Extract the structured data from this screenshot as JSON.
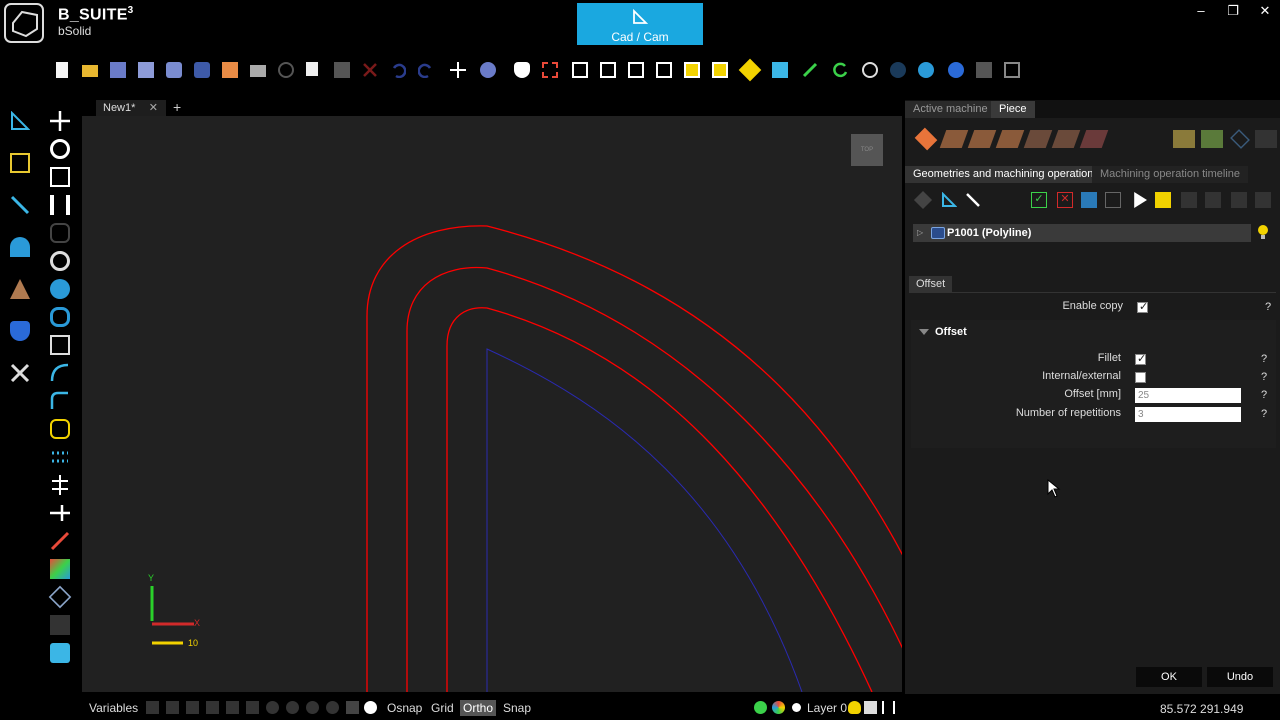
{
  "app": {
    "name": "B_SUITE",
    "name_sup": "3",
    "subtitle": "bSolid",
    "mode_button": "Cad / Cam"
  },
  "window_controls": [
    "–",
    "❐",
    "✕"
  ],
  "document_tabs": [
    {
      "label": "New1*"
    }
  ],
  "canvas": {
    "view_cube": "TOP",
    "axis": {
      "y_label": "Y",
      "x_label": "X",
      "scale_label": "10"
    }
  },
  "statusbar": {
    "variables": "Variables",
    "osnap": "Osnap",
    "grid": "Grid",
    "ortho": "Ortho",
    "snap": "Snap",
    "layer": "Layer 0"
  },
  "coordinates": "85.572  291.949",
  "right_panel": {
    "tabs": [
      "Active machine",
      "Piece"
    ],
    "active_tab": "Piece",
    "sub_tabs": [
      "Geometries and machining operations",
      "Machining operation timeline"
    ],
    "tree_item": "P1001 (Polyline)",
    "offset_tab": "Offset",
    "enable_copy": {
      "label": "Enable copy",
      "checked": true
    },
    "section_title": "Offset",
    "properties": {
      "fillet": {
        "label": "Fillet",
        "checked": true
      },
      "internal_external": {
        "label": "Internal/external",
        "checked": false
      },
      "offset": {
        "label": "Offset  [mm]",
        "value": "25"
      },
      "repetitions": {
        "label": "Number of repetitions",
        "value": "3"
      }
    },
    "help_mark": "?",
    "ok_label": "OK",
    "undo_label": "Undo"
  },
  "colors": {
    "accent": "#1aa8e0",
    "offset_curves": "#ff0000",
    "base_curve": "#2a2ab0",
    "canvas_bg": "#212121"
  }
}
